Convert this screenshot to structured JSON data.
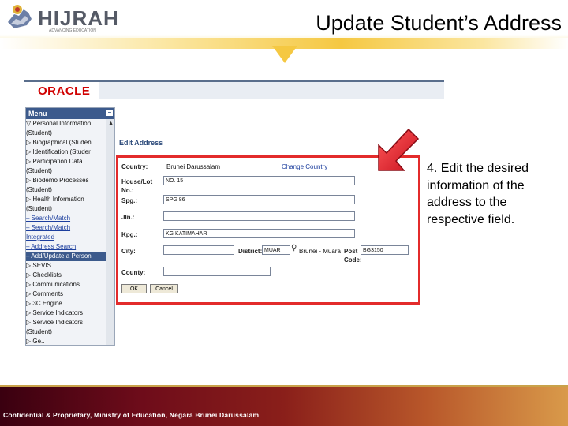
{
  "header": {
    "logo_text": "HIJRAH",
    "logo_sub": "ADVANCING EDUCATION",
    "title": "Update Student’s Address"
  },
  "app": {
    "brand": "ORACLE",
    "menu_title": "Menu",
    "menu_items": [
      {
        "label": "▽ Personal Information",
        "kind": "folder"
      },
      {
        "label": "   (Student)",
        "kind": "text"
      },
      {
        "label": "▷ Biographical (Studen",
        "kind": "folder"
      },
      {
        "label": "▷ Identification (Studer",
        "kind": "folder"
      },
      {
        "label": "▷ Participation Data",
        "kind": "folder"
      },
      {
        "label": "   (Student)",
        "kind": "text"
      },
      {
        "label": "▷ Biodemo Processes",
        "kind": "folder"
      },
      {
        "label": "   (Student)",
        "kind": "text"
      },
      {
        "label": "▷ Health Information",
        "kind": "folder"
      },
      {
        "label": "   (Student)",
        "kind": "text"
      },
      {
        "label": "– Search/Match",
        "kind": "link"
      },
      {
        "label": "– Search/Match",
        "kind": "link"
      },
      {
        "label": "   Integrated",
        "kind": "link"
      },
      {
        "label": "– Address Search",
        "kind": "link"
      },
      {
        "label": "– Add/Update a Person",
        "kind": "selected"
      },
      {
        "label": "▷ SEVIS",
        "kind": "folder"
      },
      {
        "label": "▷ Checklists",
        "kind": "folder"
      },
      {
        "label": "▷ Communications",
        "kind": "folder"
      },
      {
        "label": "▷ Comments",
        "kind": "folder"
      },
      {
        "label": "▷ 3C Engine",
        "kind": "folder"
      },
      {
        "label": "▷ Service Indicators",
        "kind": "folder"
      },
      {
        "label": "▷ Service Indicators",
        "kind": "folder"
      },
      {
        "label": "   (Student)",
        "kind": "text"
      },
      {
        "label": "▷ Ge..",
        "kind": "folder"
      }
    ],
    "form": {
      "title": "Edit Address",
      "country_label": "Country:",
      "country_value": "Brunei Darussalam",
      "change_country": "Change Country",
      "house_label": "House/Lot",
      "house_label2": "No.:",
      "house_value": "NO. 15",
      "spg_label": "Spg.:",
      "spg_value": "SPG 86",
      "jln_label": "Jln.:",
      "jln_value": "",
      "kpg_label": "Kpg.:",
      "kpg_value": "KG KATIMAHAR",
      "city_label": "City:",
      "city_value": "",
      "district_label": "District:",
      "district_value": "MUAR",
      "district_desc": "Brunei - Muara",
      "post_label": "Post",
      "post_label2": "Code:",
      "post_value": "BG3150",
      "county_label": "County:",
      "county_value": "",
      "ok_label": "OK",
      "cancel_label": "Cancel"
    }
  },
  "note": "4. Edit the desired information of the address to the respective field.",
  "footer": "Confidential & Proprietary, Ministry of Education, Negara Brunei Darussalam",
  "colors": {
    "highlight": "#e32b2b",
    "menu_header": "#3c5a8c",
    "oracle_red": "#d00000",
    "accent_gold": "#f5c842"
  }
}
